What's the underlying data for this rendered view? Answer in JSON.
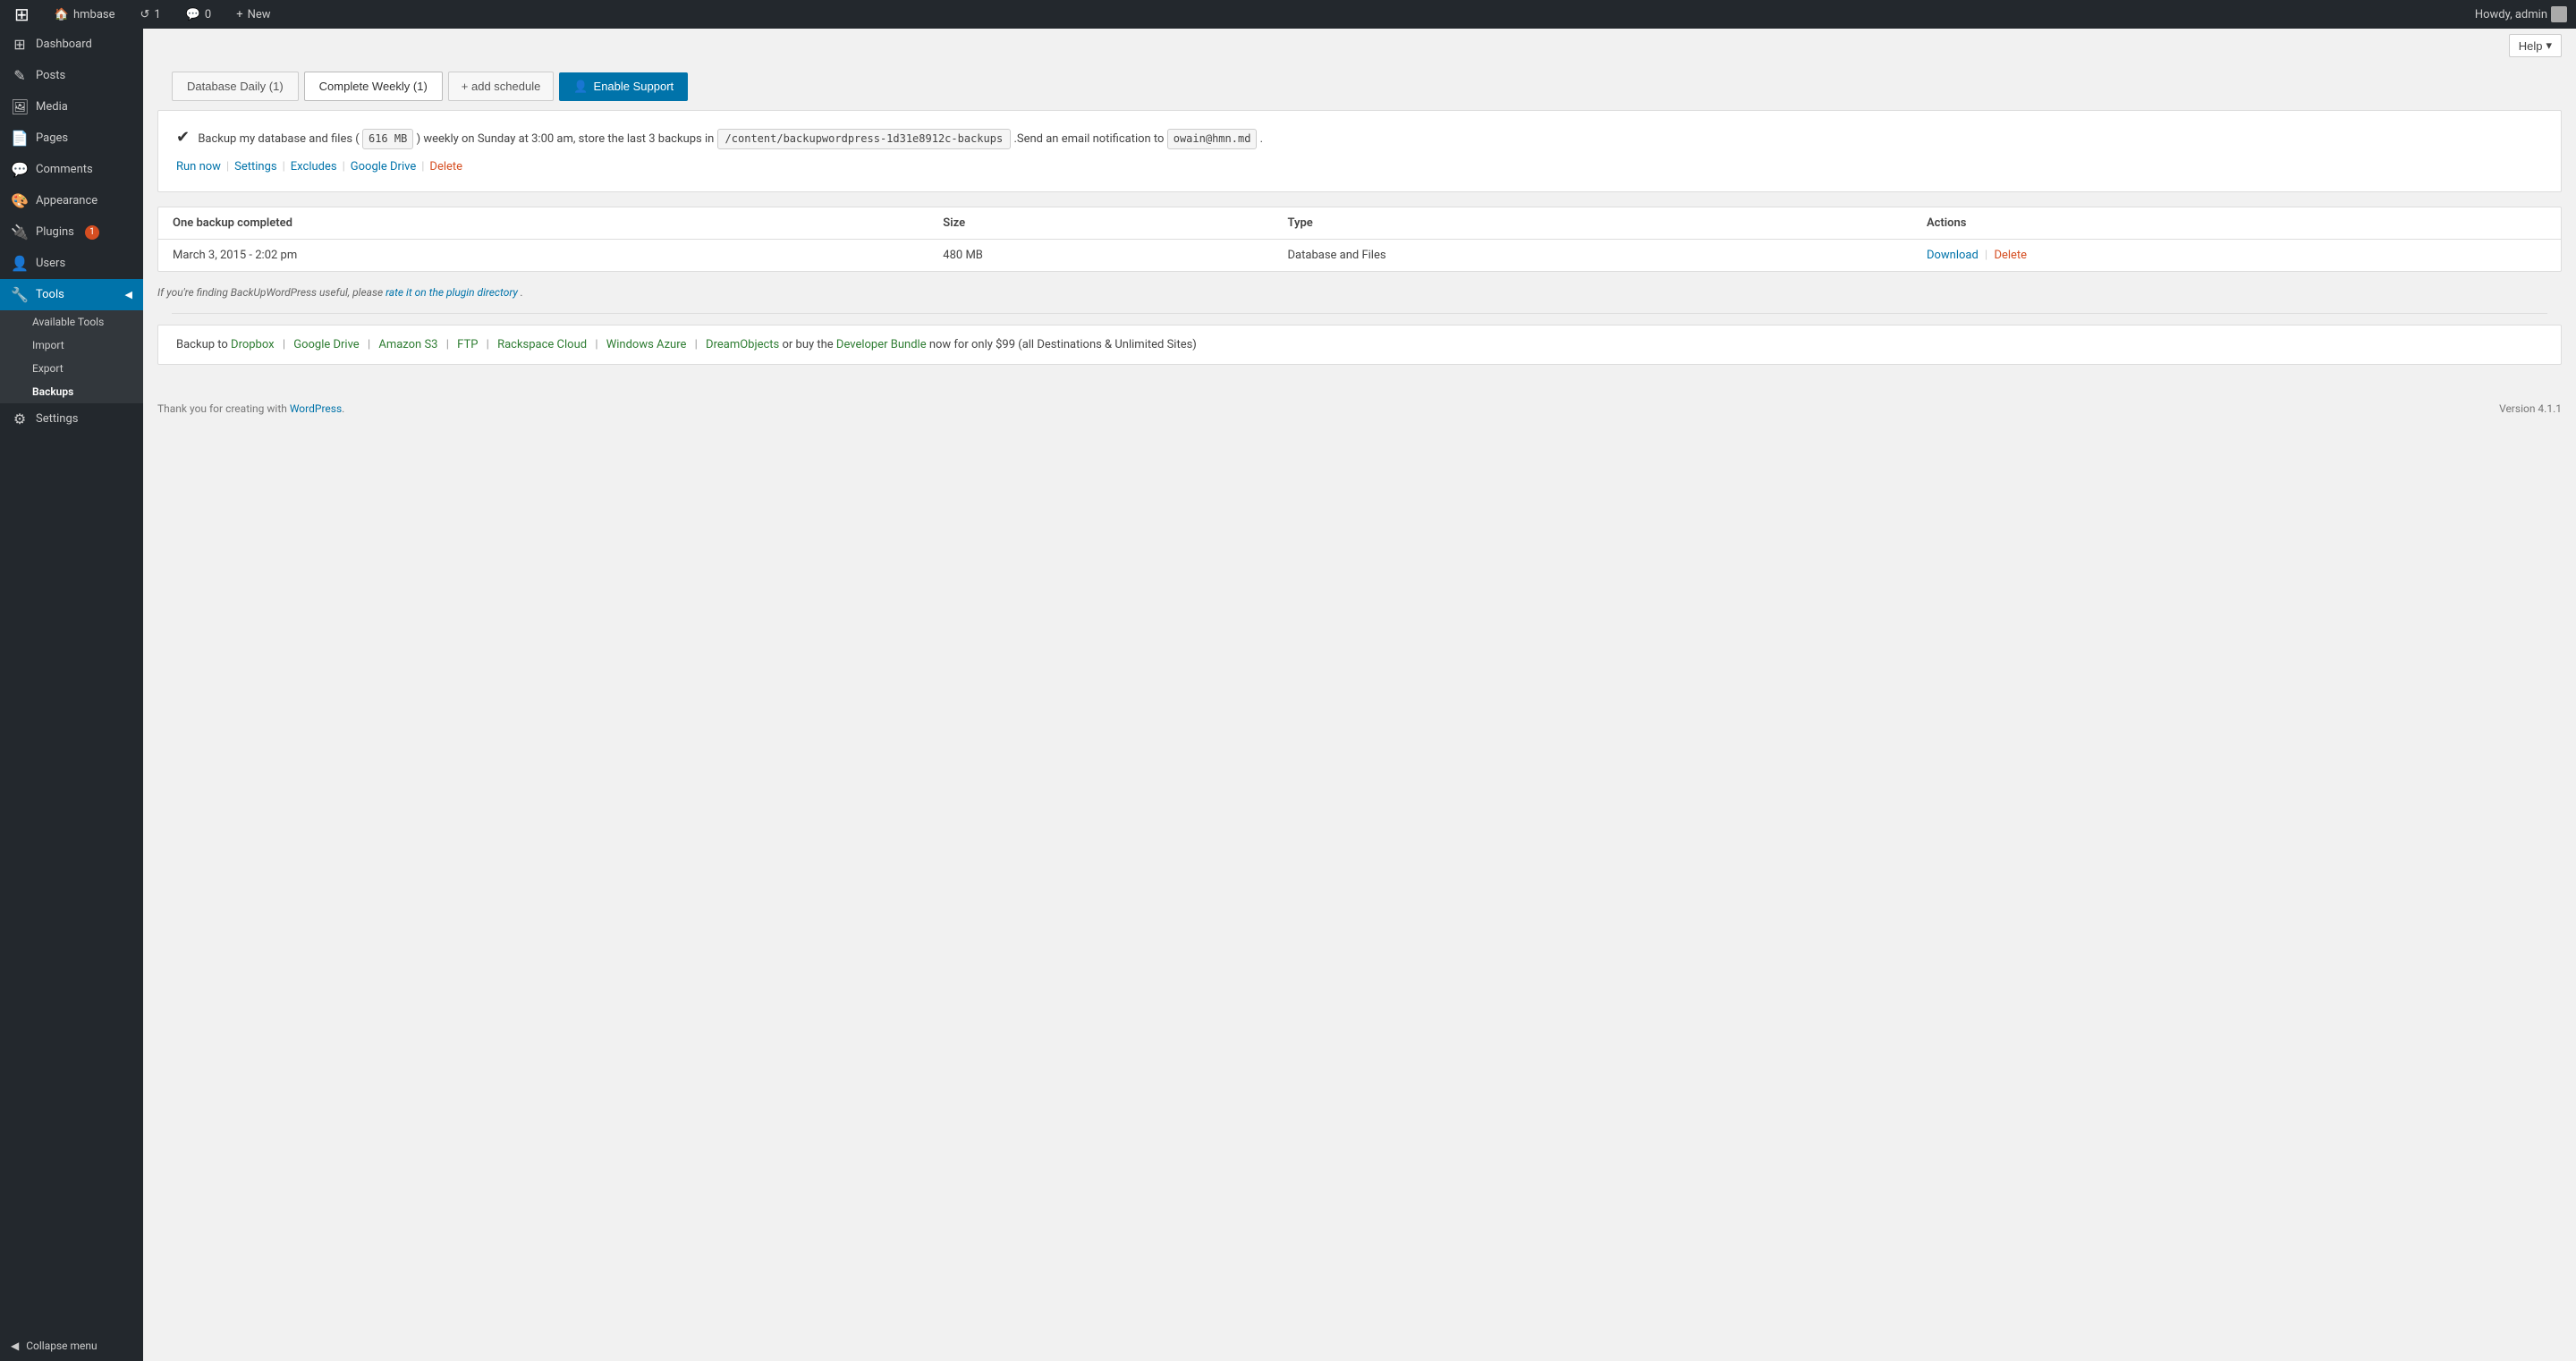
{
  "adminbar": {
    "site_name": "hmbase",
    "comment_count": "0",
    "revision_count": "1",
    "new_label": "New",
    "howdy": "Howdy, admin"
  },
  "help": {
    "label": "Help",
    "chevron": "▾"
  },
  "sidebar": {
    "items": [
      {
        "id": "dashboard",
        "label": "Dashboard",
        "icon": "⊞"
      },
      {
        "id": "posts",
        "label": "Posts",
        "icon": "✎"
      },
      {
        "id": "media",
        "label": "Media",
        "icon": "🖼"
      },
      {
        "id": "pages",
        "label": "Pages",
        "icon": "📄"
      },
      {
        "id": "comments",
        "label": "Comments",
        "icon": "💬"
      },
      {
        "id": "appearance",
        "label": "Appearance",
        "icon": "🎨"
      },
      {
        "id": "plugins",
        "label": "Plugins",
        "icon": "🔌",
        "badge": "1"
      },
      {
        "id": "users",
        "label": "Users",
        "icon": "👤"
      },
      {
        "id": "tools",
        "label": "Tools",
        "icon": "🔧",
        "active": true
      }
    ],
    "tools_subitems": [
      {
        "id": "available-tools",
        "label": "Available Tools"
      },
      {
        "id": "import",
        "label": "Import"
      },
      {
        "id": "export",
        "label": "Export"
      },
      {
        "id": "backups",
        "label": "Backups",
        "active": true
      }
    ],
    "settings": {
      "label": "Settings",
      "icon": "⚙"
    },
    "collapse": "Collapse menu"
  },
  "tabs": [
    {
      "id": "database-daily",
      "label": "Database Daily (1)",
      "active": false
    },
    {
      "id": "complete-weekly",
      "label": "Complete Weekly (1)",
      "active": true
    },
    {
      "id": "add-schedule",
      "label": "+ add schedule",
      "type": "add"
    }
  ],
  "enable_support": {
    "label": "Enable Support",
    "icon": "👤"
  },
  "backup_info": {
    "check": "✔",
    "description_before": "Backup my database and files (",
    "size_badge": "616 MB",
    "description_middle": ") weekly on Sunday at 3:00 am, store the last 3 backups in",
    "path_badge": "/content/backupwordpress-1d31e8912c-backups",
    "description_after": ".Send an email notification to",
    "email_badge": "owain@hmn.md",
    "description_end": ".",
    "links": [
      {
        "id": "run-now",
        "label": "Run now",
        "type": "normal"
      },
      {
        "id": "settings",
        "label": "Settings",
        "type": "normal"
      },
      {
        "id": "excludes",
        "label": "Excludes",
        "type": "normal"
      },
      {
        "id": "google-drive",
        "label": "Google Drive",
        "type": "normal"
      },
      {
        "id": "delete",
        "label": "Delete",
        "type": "delete"
      }
    ]
  },
  "backup_table": {
    "columns": [
      {
        "id": "name",
        "label": "One backup completed"
      },
      {
        "id": "size",
        "label": "Size"
      },
      {
        "id": "type",
        "label": "Type"
      },
      {
        "id": "actions",
        "label": "Actions"
      }
    ],
    "rows": [
      {
        "name": "March 3, 2015 - 2:02 pm",
        "size": "480 MB",
        "type": "Database and Files",
        "actions": [
          {
            "id": "download",
            "label": "Download",
            "type": "normal"
          },
          {
            "id": "delete",
            "label": "Delete",
            "type": "delete"
          }
        ]
      }
    ]
  },
  "rating_notice": {
    "prefix": "If you're finding BackUpWordPress useful, please",
    "link_text": "rate it on the plugin directory",
    "suffix": "."
  },
  "destinations": {
    "prefix": "Backup to",
    "links": [
      {
        "label": "Dropbox"
      },
      {
        "label": "Google Drive"
      },
      {
        "label": "Amazon S3"
      },
      {
        "label": "FTP"
      },
      {
        "label": "Rackspace Cloud"
      },
      {
        "label": "Windows Azure"
      },
      {
        "label": "DreamObjects"
      }
    ],
    "suffix": "or buy the",
    "bundle_link": "Developer Bundle",
    "bundle_suffix": "now for only $99 (all Destinations & Unlimited Sites)"
  },
  "footer": {
    "thanks": "Thank you for creating with",
    "wp_link": "WordPress",
    "version": "Version 4.1.1"
  }
}
